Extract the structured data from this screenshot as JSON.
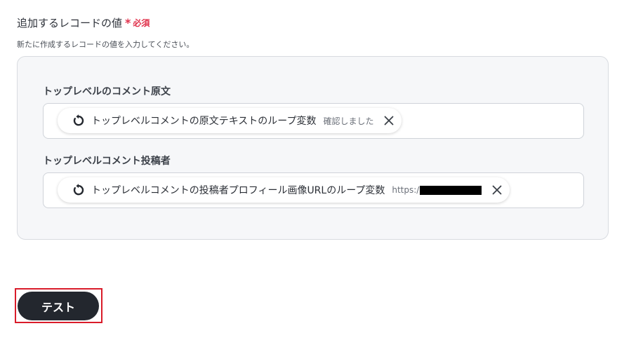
{
  "section": {
    "title": "追加するレコードの値",
    "required_star": "*",
    "required_label": "必須",
    "description": "新たに作成するレコードの値を入力してください。"
  },
  "fields": [
    {
      "label": "トップレベルのコメント原文",
      "chip": {
        "icon": "loop-variable-icon",
        "label": "トップレベルコメントの原文テキストのループ変数",
        "value": "確認しました"
      }
    },
    {
      "label": "トップレベルコメント投稿者",
      "chip": {
        "icon": "loop-variable-icon",
        "label": "トップレベルコメントの投稿者プロフィール画像URLのループ変数",
        "value": "https:/"
      }
    }
  ],
  "actions": {
    "test_label": "テスト"
  },
  "colors": {
    "required": "#e0314b",
    "panel_bg": "#f6f7f9",
    "button_bg": "#23272e",
    "highlight": "#d91c2a"
  }
}
